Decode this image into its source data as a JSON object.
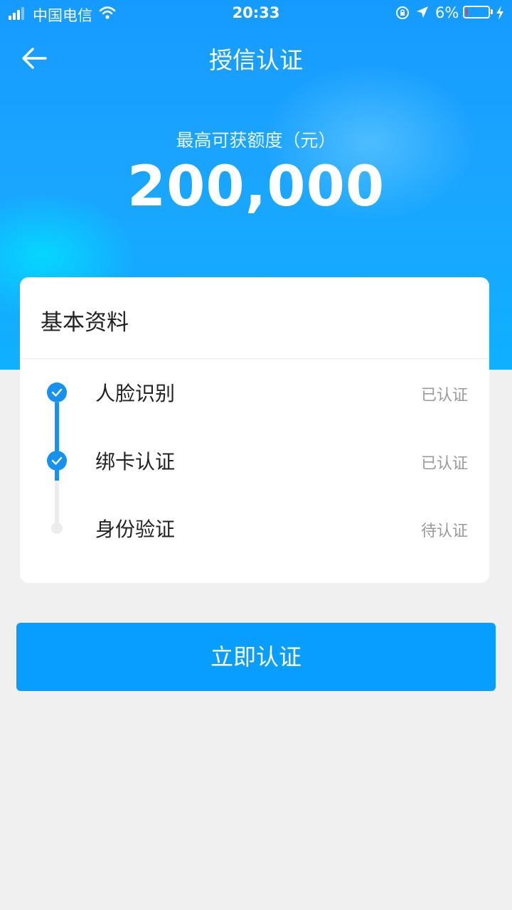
{
  "status_bar": {
    "carrier": "中国电信",
    "time": "20:33",
    "battery_percent": "6%",
    "battery_level": 0.06,
    "battery_color": "#ff3b30",
    "icons": [
      "signal-icon",
      "wifi-icon",
      "orientation-lock-icon",
      "location-arrow-icon",
      "battery-icon",
      "charging-bolt-icon"
    ]
  },
  "nav": {
    "title": "授信认证",
    "back_icon": "back-arrow-icon"
  },
  "credit": {
    "label": "最高可获额度（元）",
    "amount": "200,000"
  },
  "card": {
    "title": "基本资料",
    "steps": [
      {
        "label": "人脸识别",
        "status": "已认证",
        "done": true
      },
      {
        "label": "绑卡认证",
        "status": "已认证",
        "done": true
      },
      {
        "label": "身份验证",
        "status": "待认证",
        "done": false
      }
    ]
  },
  "action": {
    "verify_label": "立即认证"
  },
  "colors": {
    "accent": "#1691ee",
    "button": "#089eff",
    "header_gradient": [
      "#159bff",
      "#0fb0ff"
    ],
    "page_background": "#f0f0f0"
  }
}
